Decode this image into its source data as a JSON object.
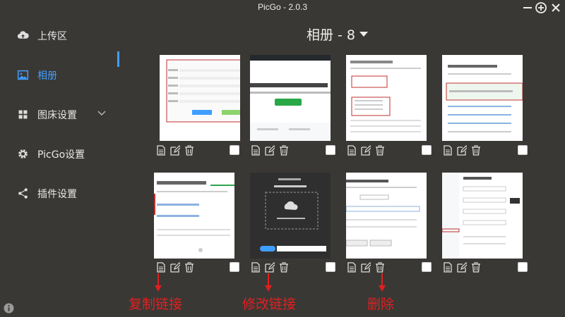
{
  "window": {
    "title": "PicGo - 2.0.3"
  },
  "sidebar": {
    "items": [
      {
        "label": "上传区",
        "icon": "cloud-upload-icon"
      },
      {
        "label": "相册",
        "icon": "image-icon",
        "active": true
      },
      {
        "label": "图床设置",
        "icon": "grid-icon"
      },
      {
        "label": "PicGo设置",
        "icon": "gear-icon"
      },
      {
        "label": "插件设置",
        "icon": "share-icon"
      }
    ]
  },
  "gallery": {
    "title": "相册 - 8"
  },
  "annotations": {
    "copy_link": "复制链接",
    "edit_link": "修改链接",
    "delete": "删除"
  },
  "colors": {
    "accent": "#409eff",
    "annotation": "#e02020",
    "background": "#3a3835"
  }
}
